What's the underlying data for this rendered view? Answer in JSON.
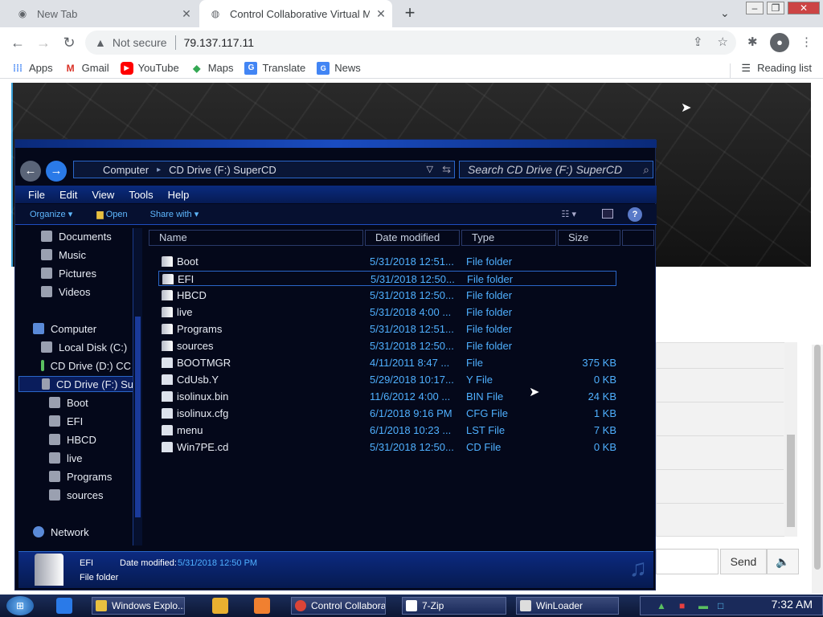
{
  "browser": {
    "tabs": [
      {
        "title": "New Tab",
        "active": false
      },
      {
        "title": "Control Collaborative Virtual Ma",
        "active": true
      }
    ],
    "address": {
      "security": "Not secure",
      "url": "79.137.117.11"
    },
    "bookmarks": [
      "Apps",
      "Gmail",
      "YouTube",
      "Maps",
      "Translate",
      "News"
    ],
    "reading_list": "Reading list"
  },
  "explorer": {
    "breadcrumb": {
      "root": "Computer",
      "location": "CD Drive (F:) SuperCD"
    },
    "search_placeholder": "Search CD Drive (F:) SuperCD",
    "menu": [
      "File",
      "Edit",
      "View",
      "Tools",
      "Help"
    ],
    "commands": {
      "organize": "Organize",
      "open": "Open",
      "share": "Share with"
    },
    "nav": {
      "libraries": [
        "Documents",
        "Music",
        "Pictures",
        "Videos"
      ],
      "computer": "Computer",
      "drives": [
        "Local Disk (C:)",
        "CD Drive (D:) CC",
        "CD Drive (F:) Su"
      ],
      "folders": [
        "Boot",
        "EFI",
        "HBCD",
        "live",
        "Programs",
        "sources"
      ],
      "network": "Network"
    },
    "columns": [
      "Name",
      "Date modified",
      "Type",
      "Size"
    ],
    "files": [
      {
        "name": "Boot",
        "date": "5/31/2018 12:51...",
        "type": "File folder",
        "size": ""
      },
      {
        "name": "EFI",
        "date": "5/31/2018 12:50...",
        "type": "File folder",
        "size": ""
      },
      {
        "name": "HBCD",
        "date": "5/31/2018 12:50...",
        "type": "File folder",
        "size": ""
      },
      {
        "name": "live",
        "date": "5/31/2018 4:00 ...",
        "type": "File folder",
        "size": ""
      },
      {
        "name": "Programs",
        "date": "5/31/2018 12:51...",
        "type": "File folder",
        "size": ""
      },
      {
        "name": "sources",
        "date": "5/31/2018 12:50...",
        "type": "File folder",
        "size": ""
      },
      {
        "name": "BOOTMGR",
        "date": "4/11/2011 8:47 ...",
        "type": "File",
        "size": "375 KB"
      },
      {
        "name": "CdUsb.Y",
        "date": "5/29/2018 10:17...",
        "type": "Y File",
        "size": "0 KB"
      },
      {
        "name": "isolinux.bin",
        "date": "11/6/2012 4:00 ...",
        "type": "BIN File",
        "size": "24 KB"
      },
      {
        "name": "isolinux.cfg",
        "date": "6/1/2018 9:16 PM",
        "type": "CFG File",
        "size": "1 KB"
      },
      {
        "name": "menu",
        "date": "6/1/2018 10:23 ...",
        "type": "LST File",
        "size": "7 KB"
      },
      {
        "name": "Win7PE.cd",
        "date": "5/31/2018 12:50...",
        "type": "CD File",
        "size": "0 KB"
      }
    ],
    "details": {
      "name": "EFI",
      "label": "Date modified:",
      "value": "5/31/2018 12:50 PM",
      "type": "File folder"
    }
  },
  "chat": {
    "send": "Send"
  },
  "taskbar": {
    "items": [
      "Windows Explo...",
      "Control Collabora...",
      "7-Zip",
      "WinLoader"
    ],
    "clock": "7:32 AM"
  }
}
